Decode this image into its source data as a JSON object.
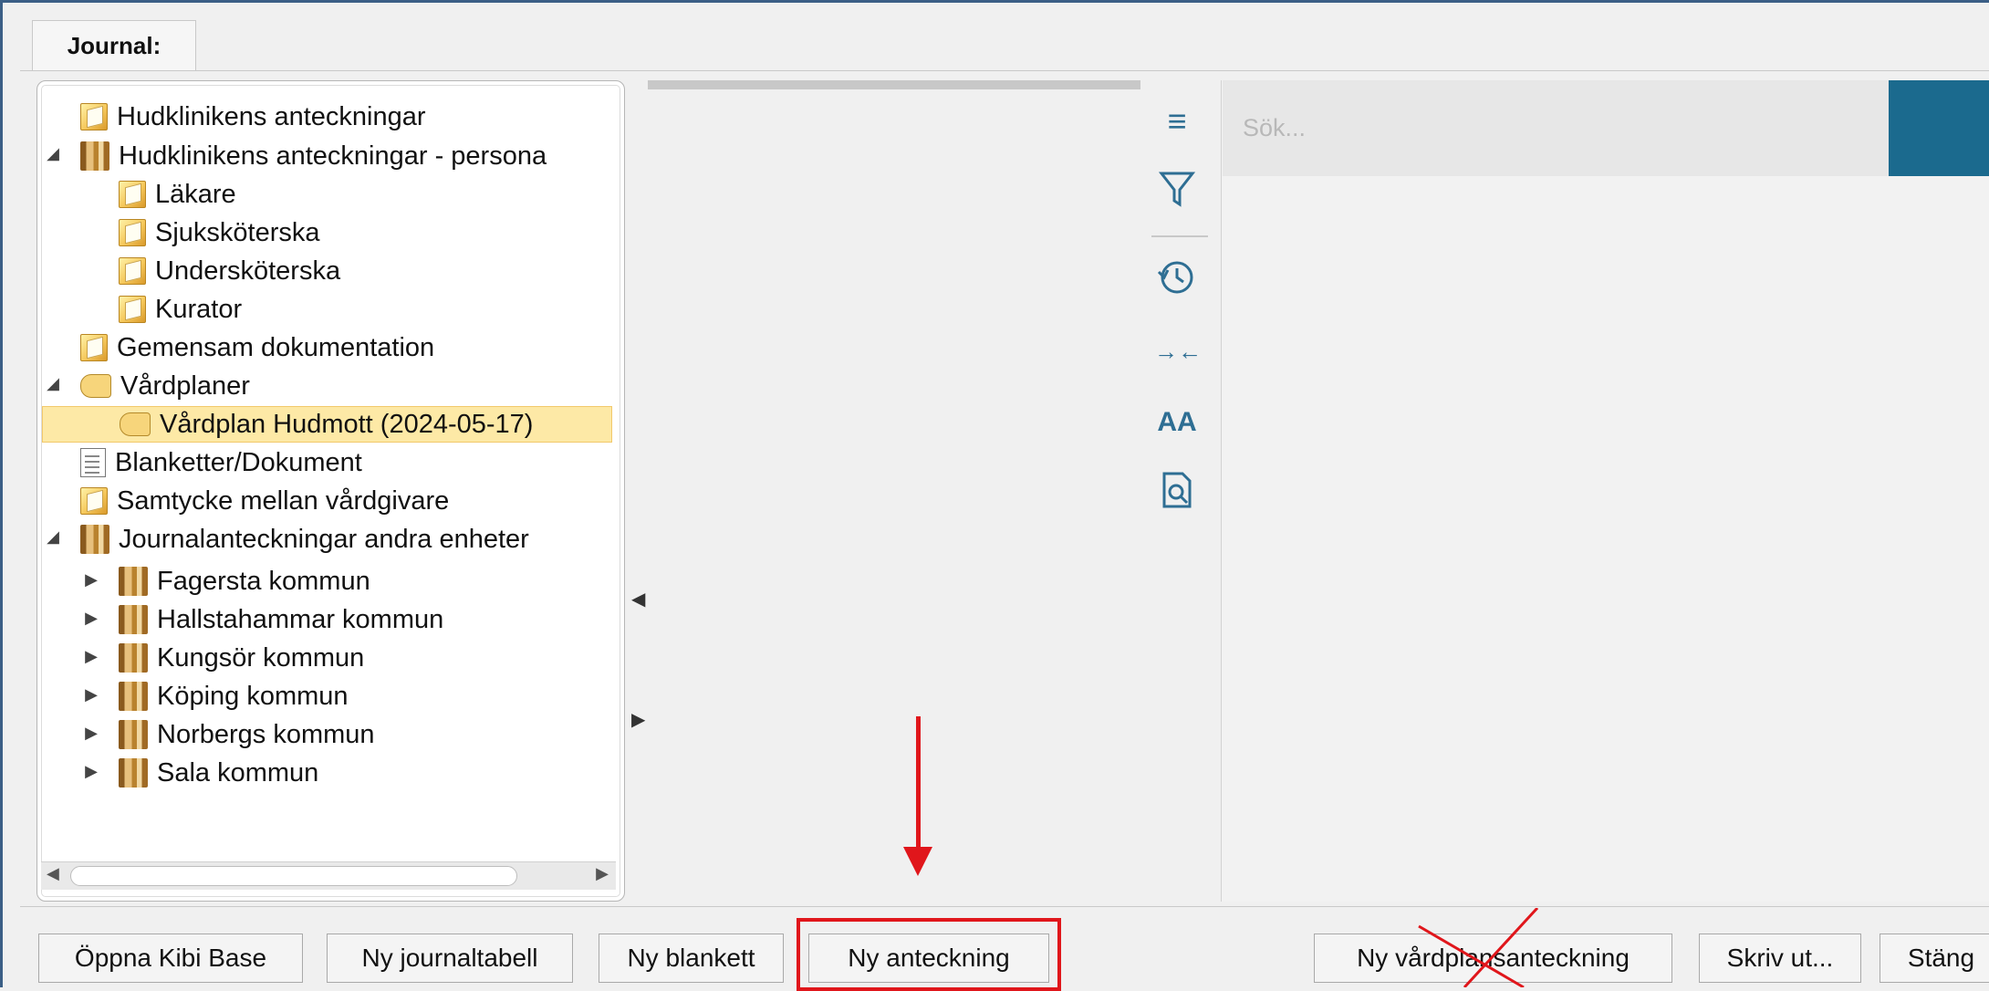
{
  "journal_tab": {
    "label": "Journal:"
  },
  "tree": {
    "items": [
      {
        "label": "Hudklinikens anteckningar",
        "icon": "folder-icon"
      },
      {
        "label": "Hudklinikens anteckningar - persona",
        "icon": "bookstack-icon",
        "expander": "expanded"
      },
      {
        "label": "Läkare",
        "icon": "folder-icon"
      },
      {
        "label": "Sjuksköterska",
        "icon": "folder-icon"
      },
      {
        "label": "Undersköterska",
        "icon": "folder-icon"
      },
      {
        "label": "Kurator",
        "icon": "folder-icon"
      },
      {
        "label": "Gemensam dokumentation",
        "icon": "folder-icon"
      },
      {
        "label": "Vårdplaner",
        "icon": "hand-icon",
        "expander": "expanded"
      },
      {
        "label": "Vårdplan Hudmott (2024-05-17)",
        "icon": "hand-icon",
        "selected": true
      },
      {
        "label": "Blanketter/Dokument",
        "icon": "document-icon"
      },
      {
        "label": "Samtycke mellan vårdgivare",
        "icon": "folder-icon"
      },
      {
        "label": "Journalanteckningar andra enheter",
        "icon": "bookstack-icon",
        "expander": "expanded"
      },
      {
        "label": "Fagersta kommun",
        "icon": "bookstack-icon",
        "expander": "collapsed"
      },
      {
        "label": "Hallstahammar kommun",
        "icon": "bookstack-icon",
        "expander": "collapsed"
      },
      {
        "label": "Kungsör kommun",
        "icon": "bookstack-icon",
        "expander": "collapsed"
      },
      {
        "label": "Köping kommun",
        "icon": "bookstack-icon",
        "expander": "collapsed"
      },
      {
        "label": "Norbergs kommun",
        "icon": "bookstack-icon",
        "expander": "collapsed"
      },
      {
        "label": "Sala kommun",
        "icon": "bookstack-icon",
        "expander": "collapsed"
      }
    ]
  },
  "toolbar": {
    "icons": [
      "menu-icon",
      "filter-icon",
      "history-icon",
      "collapse-icon",
      "font-size-icon",
      "preview-icon"
    ]
  },
  "search": {
    "placeholder": "Sök..."
  },
  "buttons": {
    "open_kibi": "Öppna Kibi Base",
    "new_table": "Ny journaltabell",
    "new_form": "Ny blankett",
    "new_note": "Ny anteckning",
    "new_careplan_note": "Ny vårdplansanteckning",
    "print": "Skriv ut...",
    "close": "Stäng"
  },
  "colors": {
    "accent": "#1b6a8e",
    "annotation_red": "#e0161b",
    "selection": "#fde9a6"
  }
}
